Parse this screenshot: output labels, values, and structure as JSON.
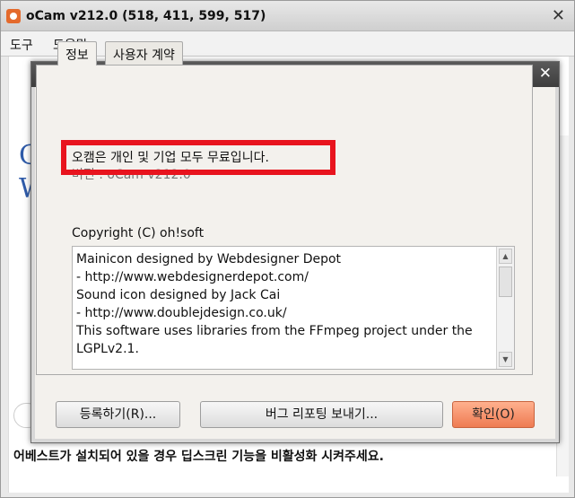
{
  "outer": {
    "title": "oCam v212.0 (518, 411, 599, 517)",
    "menu": [
      "도구",
      "도움말"
    ],
    "close_glyph": "✕",
    "bg_glyphs": [
      "G",
      "W"
    ],
    "bottom_notice": "어베스트가 설치되어 있을 경우 딥스크린 기능을 비활성화 시켜주세요."
  },
  "dialog": {
    "title": "정보",
    "close_glyph": "✕",
    "tabs": [
      "정보",
      "사용자 계약"
    ],
    "info_line_1": "오캠은 개인 및 기업 모두 무료입니다.",
    "info_line_2": "버전 : oCam v212.0",
    "copyright": "Copyright (C) oh!soft",
    "credits": [
      "Mainicon designed by Webdesigner Depot",
      "- http://www.webdesignerdepot.com/",
      "Sound icon designed by Jack Cai",
      "- http://www.doublejdesign.co.uk/",
      "This software uses libraries from the FFmpeg project under the LGPLv2.1."
    ],
    "buttons": {
      "register": "등록하기(R)...",
      "bug_report": "버그 리포팅 보내기...",
      "ok": "확인(O)"
    }
  },
  "colors": {
    "highlight": "#e8141e",
    "primary_button": "#ee7b52"
  }
}
